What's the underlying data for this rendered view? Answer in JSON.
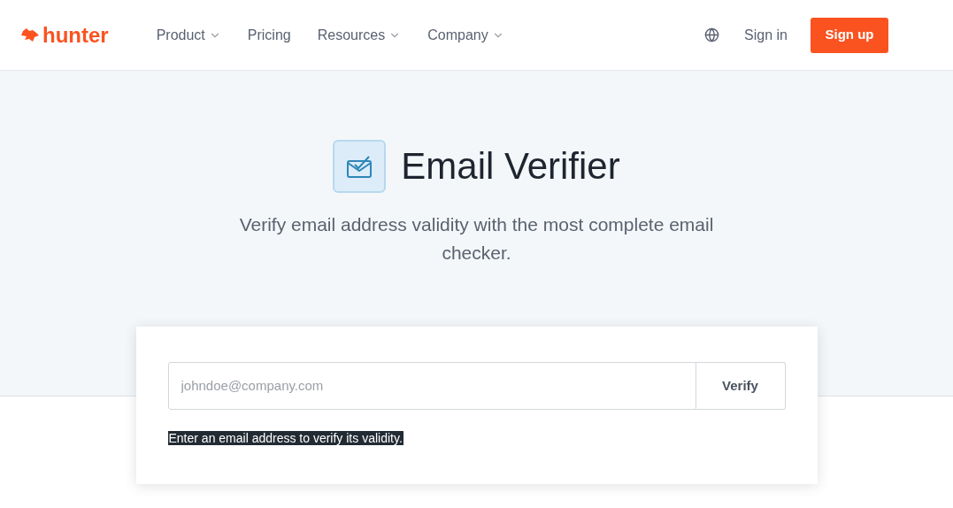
{
  "header": {
    "logo": "hunter",
    "nav": [
      {
        "label": "Product",
        "dropdown": true
      },
      {
        "label": "Pricing",
        "dropdown": false
      },
      {
        "label": "Resources",
        "dropdown": true
      },
      {
        "label": "Company",
        "dropdown": true
      }
    ],
    "sign_in": "Sign in",
    "sign_up": "Sign up"
  },
  "hero": {
    "title": "Email Verifier",
    "subtitle": "Verify email address validity with the most complete email checker."
  },
  "form": {
    "email": {
      "placeholder": "johndoe@company.com"
    },
    "button": "Verify",
    "hint": {
      "text": "Enter an email address to verify its validity.",
      "highlighted": true
    }
  }
}
